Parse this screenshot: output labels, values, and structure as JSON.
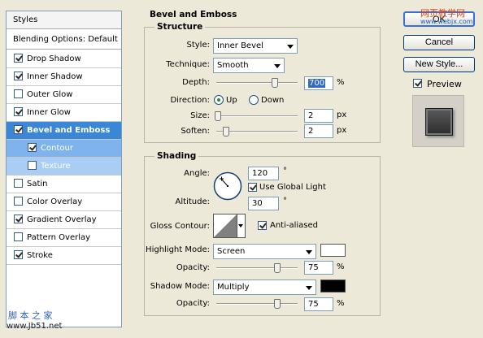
{
  "styles_panel": {
    "header": "Styles",
    "blending_options": "Blending Options: Default",
    "items": [
      {
        "label": "Drop Shadow",
        "checked": true
      },
      {
        "label": "Inner Shadow",
        "checked": true
      },
      {
        "label": "Outer Glow",
        "checked": false
      },
      {
        "label": "Inner Glow",
        "checked": true
      },
      {
        "label": "Bevel and Emboss",
        "checked": true,
        "selected": true
      },
      {
        "label": "Contour",
        "checked": true,
        "sub": true
      },
      {
        "label": "Texture",
        "checked": false,
        "sub": true
      },
      {
        "label": "Satin",
        "checked": false
      },
      {
        "label": "Color Overlay",
        "checked": false
      },
      {
        "label": "Gradient Overlay",
        "checked": true
      },
      {
        "label": "Pattern Overlay",
        "checked": false
      },
      {
        "label": "Stroke",
        "checked": true
      }
    ]
  },
  "bevel": {
    "title": "Bevel and Emboss",
    "structure": {
      "legend": "Structure",
      "style_label": "Style:",
      "style_value": "Inner Bevel",
      "technique_label": "Technique:",
      "technique_value": "Smooth",
      "depth_label": "Depth:",
      "depth_value": "700",
      "depth_unit": "%",
      "depth_level": 0.72,
      "direction_label": "Direction:",
      "direction_up": "Up",
      "direction_down": "Down",
      "direction_selected": "Up",
      "size_label": "Size:",
      "size_value": "2",
      "size_unit": "px",
      "size_level": 0.02,
      "soften_label": "Soften:",
      "soften_value": "2",
      "soften_unit": "px",
      "soften_level": 0.12
    },
    "shading": {
      "legend": "Shading",
      "angle_label": "Angle:",
      "angle_value": "120",
      "angle_unit": "°",
      "use_global_light_label": "Use Global Light",
      "use_global_light": true,
      "altitude_label": "Altitude:",
      "altitude_value": "30",
      "altitude_unit": "°",
      "gloss_contour_label": "Gloss Contour:",
      "anti_aliased_label": "Anti-aliased",
      "anti_aliased": true,
      "highlight_mode_label": "Highlight Mode:",
      "highlight_mode_value": "Screen",
      "highlight_color": "#ffffff",
      "highlight_opacity_label": "Opacity:",
      "highlight_opacity_value": "75",
      "highlight_opacity_unit": "%",
      "shadow_mode_label": "Shadow Mode:",
      "shadow_mode_value": "Multiply",
      "shadow_color": "#000000",
      "shadow_opacity_label": "Opacity:",
      "shadow_opacity_value": "75",
      "shadow_opacity_unit": "%"
    }
  },
  "buttons": {
    "ok": "OK",
    "cancel": "Cancel",
    "new_style": "New Style...",
    "preview_label": "Preview",
    "preview_checked": true
  },
  "watermarks": {
    "top_right": "网页教学网",
    "top_right_url": "www.webjx.com",
    "bottom_left": "脚 本 之 家",
    "bottom_left_url": "www.Jb51.net"
  }
}
